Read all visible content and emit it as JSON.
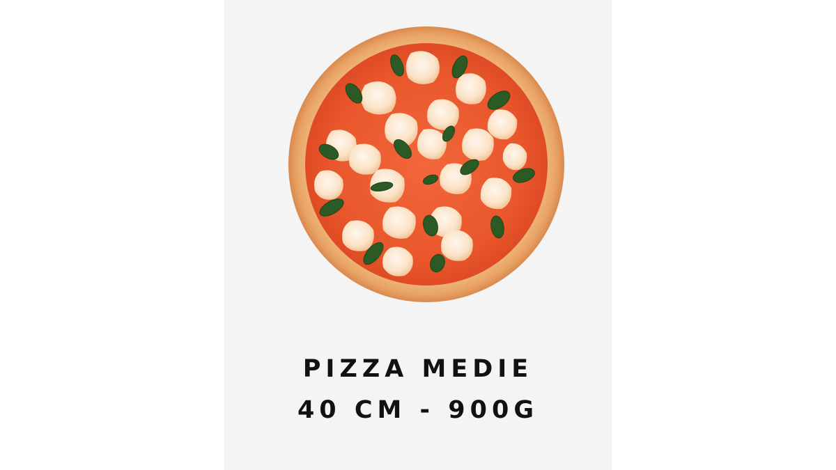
{
  "product": {
    "title": "PIZZA MEDIE",
    "spec": "40 CM - 900G",
    "image_icon": "pizza-margherita-icon"
  },
  "colors": {
    "card_background": "#f4f4f4",
    "page_background": "#ffffff",
    "text": "#111111",
    "crust": "#e7a56b",
    "sauce": "#e8542c",
    "cheese": "#fbe6cf",
    "basil": "#2c5a24"
  }
}
